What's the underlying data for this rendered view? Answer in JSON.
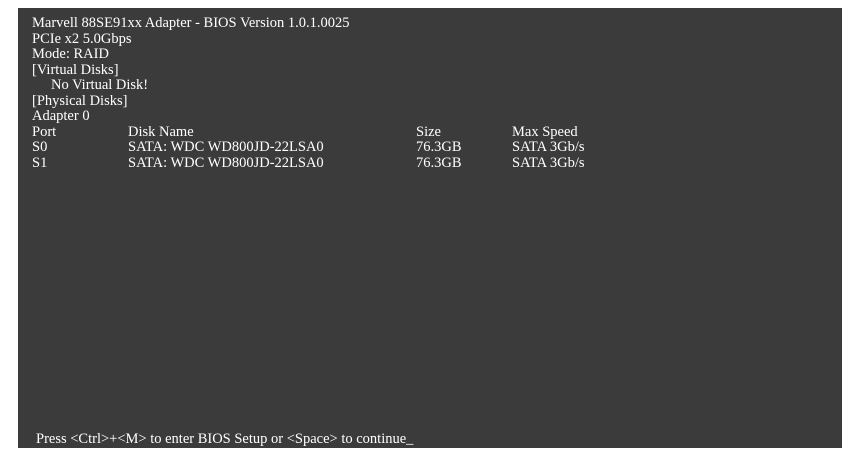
{
  "header": {
    "title": "Marvell 88SE91xx Adapter - BIOS Version 1.0.1.0025",
    "link": "PCIe x2 5.0Gbps",
    "mode": "Mode: RAID"
  },
  "virtual_disks": {
    "heading": "[Virtual Disks]",
    "message": "No Virtual Disk!"
  },
  "physical_disks": {
    "heading": "[Physical Disks]",
    "adapter": "Adapter 0",
    "columns": {
      "port": "Port",
      "name": "Disk Name",
      "size": "Size",
      "speed": "Max Speed"
    },
    "rows": [
      {
        "port": "S0",
        "name": "SATA: WDC WD800JD-22LSA0",
        "size": "76.3GB",
        "speed": "SATA 3Gb/s"
      },
      {
        "port": "S1",
        "name": "SATA: WDC WD800JD-22LSA0",
        "size": "76.3GB",
        "speed": "SATA 3Gb/s"
      }
    ]
  },
  "footer": {
    "prompt": "Press <Ctrl>+<M> to enter BIOS Setup or <Space> to continue_"
  },
  "colors": {
    "background": "#3b3b3b",
    "text": "#ffffff"
  }
}
